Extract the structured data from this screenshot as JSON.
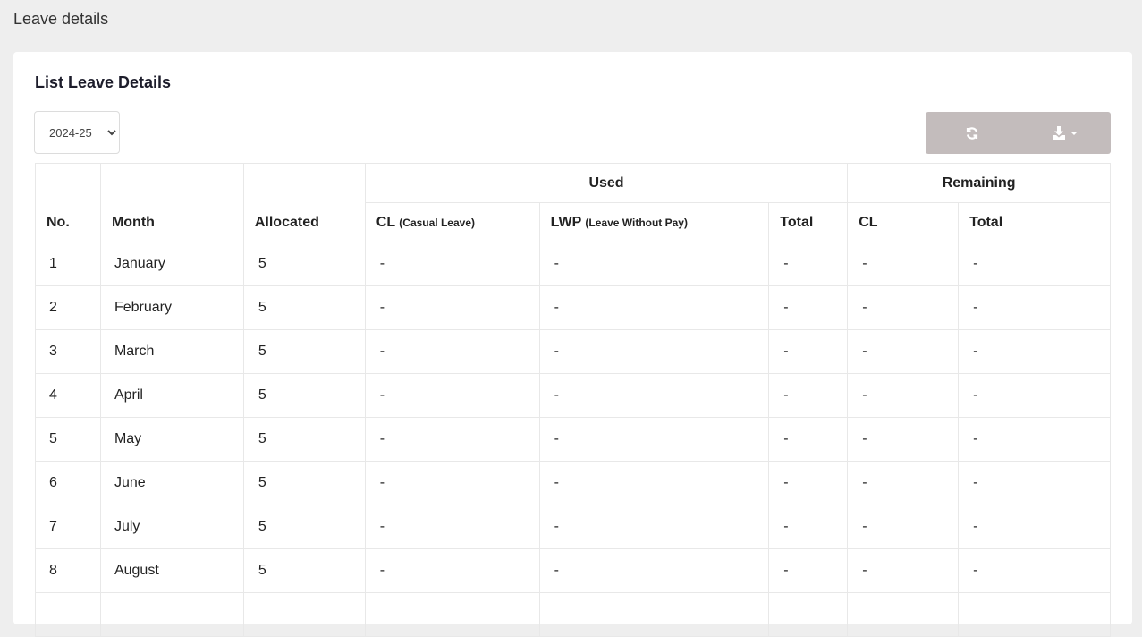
{
  "page": {
    "title": "Leave details"
  },
  "card": {
    "title": "List Leave Details"
  },
  "year_select": {
    "selected": "2024-25"
  },
  "toolbar": {
    "refresh_icon": "refresh-icon",
    "download_icon": "download-icon"
  },
  "table": {
    "headers": {
      "no": "No.",
      "month": "Month",
      "allocated": "Allocated",
      "used": "Used",
      "remaining": "Remaining",
      "used_cl": "CL",
      "used_cl_note": "(Casual Leave)",
      "used_lwp": "LWP",
      "used_lwp_note": "(Leave Without Pay)",
      "used_total": "Total",
      "remaining_cl": "CL",
      "remaining_total": "Total"
    },
    "rows": [
      {
        "no": "1",
        "month": "January",
        "allocated": "5",
        "used_cl": "-",
        "used_lwp": "-",
        "used_total": "-",
        "remaining_cl": "-",
        "remaining_total": "-"
      },
      {
        "no": "2",
        "month": "February",
        "allocated": "5",
        "used_cl": "-",
        "used_lwp": "-",
        "used_total": "-",
        "remaining_cl": "-",
        "remaining_total": "-"
      },
      {
        "no": "3",
        "month": "March",
        "allocated": "5",
        "used_cl": "-",
        "used_lwp": "-",
        "used_total": "-",
        "remaining_cl": "-",
        "remaining_total": "-"
      },
      {
        "no": "4",
        "month": "April",
        "allocated": "5",
        "used_cl": "-",
        "used_lwp": "-",
        "used_total": "-",
        "remaining_cl": "-",
        "remaining_total": "-"
      },
      {
        "no": "5",
        "month": "May",
        "allocated": "5",
        "used_cl": "-",
        "used_lwp": "-",
        "used_total": "-",
        "remaining_cl": "-",
        "remaining_total": "-"
      },
      {
        "no": "6",
        "month": "June",
        "allocated": "5",
        "used_cl": "-",
        "used_lwp": "-",
        "used_total": "-",
        "remaining_cl": "-",
        "remaining_total": "-"
      },
      {
        "no": "7",
        "month": "July",
        "allocated": "5",
        "used_cl": "-",
        "used_lwp": "-",
        "used_total": "-",
        "remaining_cl": "-",
        "remaining_total": "-"
      },
      {
        "no": "8",
        "month": "August",
        "allocated": "5",
        "used_cl": "-",
        "used_lwp": "-",
        "used_total": "-",
        "remaining_cl": "-",
        "remaining_total": "-"
      },
      {
        "no": "",
        "month": "",
        "allocated": "",
        "used_cl": "",
        "used_lwp": "",
        "used_total": "",
        "remaining_cl": "",
        "remaining_total": ""
      }
    ]
  }
}
